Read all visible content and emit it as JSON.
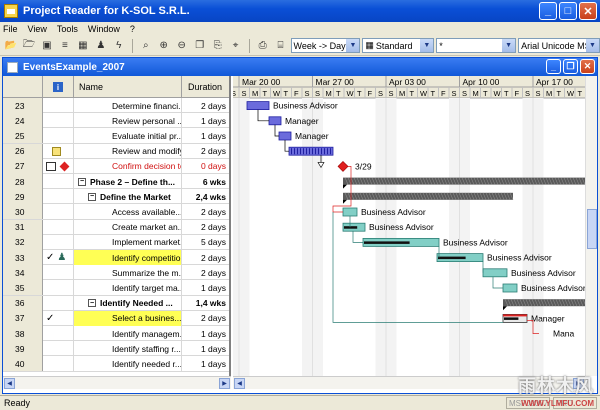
{
  "window": {
    "title": "Project Reader for K-SOL S.R.L."
  },
  "menu": [
    "File",
    "View",
    "Tools",
    "Window",
    "?"
  ],
  "toolbar": {
    "timescale": "Week -> Day",
    "view": "Standard",
    "filter": "*",
    "font": "Arial Unicode MS"
  },
  "document": {
    "title": "EventsExample_2007"
  },
  "columns": {
    "indicator": "i",
    "name": "Name",
    "duration": "Duration"
  },
  "rows": [
    {
      "id": "23",
      "name": "Determine financi...",
      "duration": "2 days",
      "indent": 2
    },
    {
      "id": "24",
      "name": "Review personal ...",
      "duration": "1 days",
      "indent": 2
    },
    {
      "id": "25",
      "name": "Evaluate initial pr...",
      "duration": "1 days",
      "indent": 2
    },
    {
      "id": "26",
      "name": "Review and modify t...",
      "duration": "2 days",
      "indent": 2,
      "icon": "note"
    },
    {
      "id": "27",
      "name": "Confirm decision to ...",
      "duration": "0 days",
      "indent": 2,
      "icon": "table-note",
      "red": true
    },
    {
      "id": "28",
      "name": "Phase 2 – Define th...",
      "duration": "6 wks",
      "indent": 0,
      "bold": true,
      "collapse": true
    },
    {
      "id": "29",
      "name": "Define the Market",
      "duration": "2,4 wks",
      "indent": 1,
      "bold": true,
      "collapse": true
    },
    {
      "id": "30",
      "name": "Access available...",
      "duration": "2 days",
      "indent": 2
    },
    {
      "id": "31",
      "name": "Create market an...",
      "duration": "2 days",
      "indent": 2
    },
    {
      "id": "32",
      "name": "Implement market...",
      "duration": "5 days",
      "indent": 2
    },
    {
      "id": "33",
      "name": "Identify competition",
      "duration": "2 days",
      "indent": 2,
      "icon": "check-person",
      "highlight": true
    },
    {
      "id": "34",
      "name": "Summarize the m...",
      "duration": "2 days",
      "indent": 2
    },
    {
      "id": "35",
      "name": "Identify target ma...",
      "duration": "1 days",
      "indent": 2
    },
    {
      "id": "36",
      "name": "Identify Needed ...",
      "duration": "1,4 wks",
      "indent": 1,
      "bold": true,
      "collapse": true
    },
    {
      "id": "37",
      "name": "Select a busines...",
      "duration": "2 days",
      "indent": 2,
      "icon": "check",
      "highlight": true
    },
    {
      "id": "38",
      "name": "Identify managem...",
      "duration": "1 days",
      "indent": 2
    },
    {
      "id": "39",
      "name": "Identify staffing r...",
      "duration": "1 days",
      "indent": 2
    },
    {
      "id": "40",
      "name": "Identify needed r...",
      "duration": "1 days",
      "indent": 2
    }
  ],
  "timeline": {
    "weeks": [
      "Mar 20 00",
      "Mar 27 00",
      "Apr 03 00",
      "Apr 10 00",
      "Apr 17 00"
    ],
    "days": [
      "S",
      "M",
      "T",
      "W",
      "T",
      "F",
      "S"
    ]
  },
  "gantt_labels": {
    "milestone_date": "3/29",
    "resources": [
      "Business Advisor",
      "Manager",
      "Manager",
      "Business Advisor",
      "Business Advisor",
      "Business Advisor",
      "Business Advisor",
      "Business Advisor",
      "Business Advisor",
      "Manager",
      "Mana"
    ]
  },
  "status": {
    "text": "Ready",
    "panel1": "MSPJ2007",
    "panel2": "PRO"
  },
  "watermark": {
    "line1": "雨林木风",
    "line2": "WWW.YLMFU.COM"
  }
}
